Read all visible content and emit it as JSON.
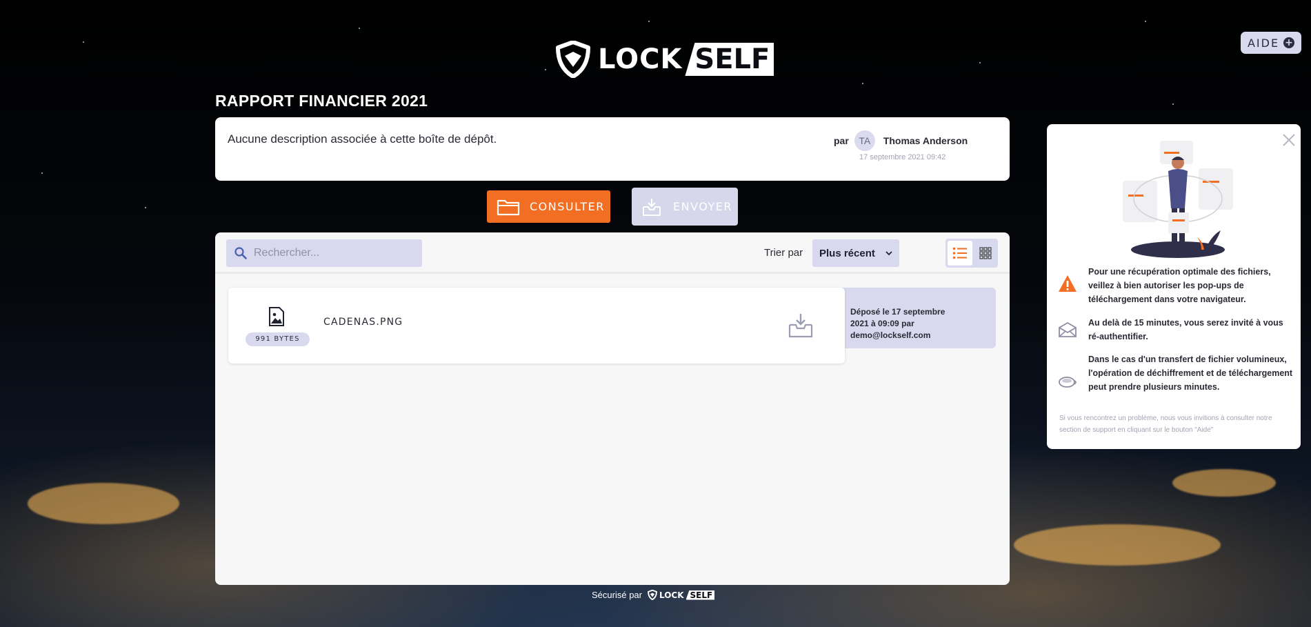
{
  "brand": {
    "logo_left": "LOCK",
    "logo_right": "SELF"
  },
  "header": {
    "help_label": "AIDE"
  },
  "dropbox": {
    "title": "RAPPORT FINANCIER 2021",
    "description": "Aucune description associée à cette boîte de dépôt.",
    "by_label": "par",
    "author_initials": "TA",
    "author_name": "Thomas Anderson",
    "created_at": "17 septembre 2021 09:42"
  },
  "actions": {
    "consult_label": "CONSULTER",
    "send_label": "ENVOYER"
  },
  "toolbar": {
    "search_placeholder": "Rechercher...",
    "sort_label": "Trier par",
    "sort_value": "Plus récent"
  },
  "files": [
    {
      "name": "CADENAS.PNG",
      "size": "991 BYTES",
      "deposit_line1": "Déposé le 17 septembre",
      "deposit_line2": "2021 à 09:09 par demo@lockself.com"
    }
  ],
  "info": {
    "items": [
      {
        "icon": "warning-icon",
        "text": "Pour une récupération optimale des fichiers, veillez à bien autoriser les pop-ups de téléchargement dans votre navigateur."
      },
      {
        "icon": "envelope-icon",
        "text": "Au delà de 15 minutes, vous serez invité à vous ré-authentifier."
      },
      {
        "icon": "coffee-icon",
        "text": "Dans le cas d'un transfert de fichier volumineux, l'opération de déchiffrement et de téléchargement peut prendre plusieurs minutes."
      }
    ],
    "note": "Si vous rencontrez un problème, nous vous invitions à consulter notre section de support en cliquant sur le bouton \"Aide\""
  },
  "footer": {
    "secured_by": "Sécurisé par",
    "logo_left": "LOCK",
    "logo_right": "SELF"
  },
  "colors": {
    "accent": "#f26e22",
    "soft": "#d8d9ee",
    "text": "#2a2a35"
  }
}
